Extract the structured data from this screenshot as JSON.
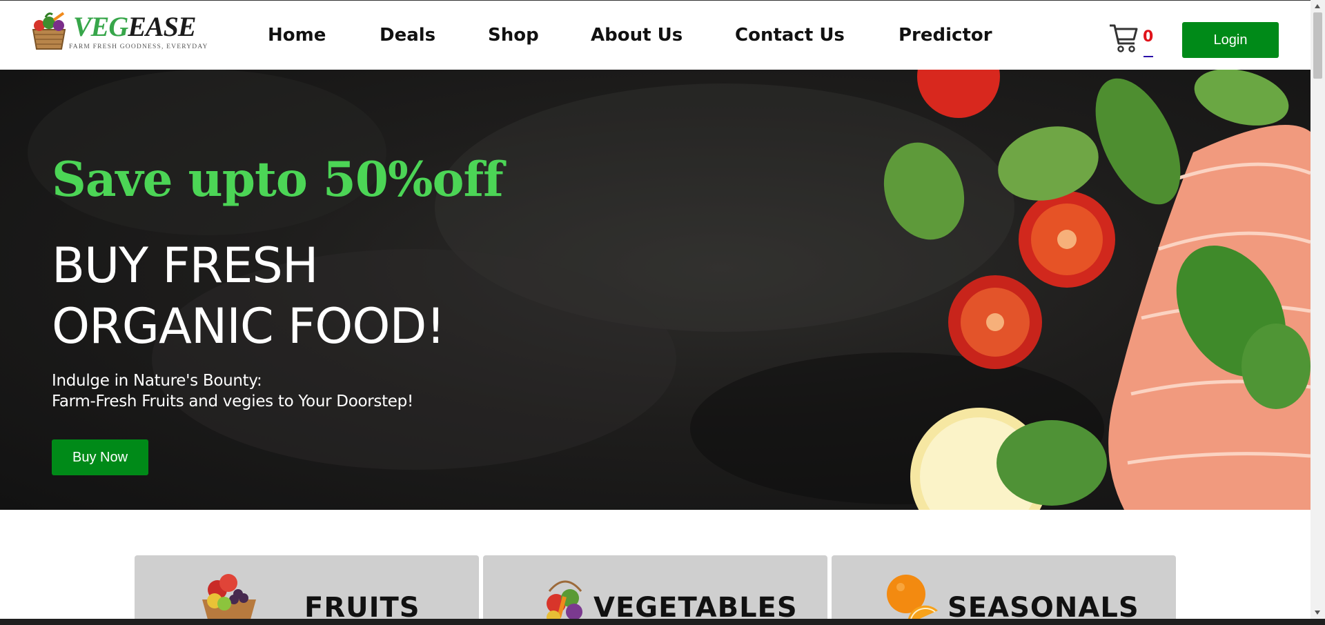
{
  "brand": {
    "name_part1": "VEG",
    "name_part2": "EASE",
    "tagline": "FARM FRESH GOODNESS, EVERYDAY",
    "icon": "vegetable-basket-logo"
  },
  "nav": {
    "items": [
      {
        "label": "Home"
      },
      {
        "label": "Deals"
      },
      {
        "label": "Shop"
      },
      {
        "label": "About Us"
      },
      {
        "label": "Contact Us"
      },
      {
        "label": "Predictor"
      }
    ]
  },
  "cart": {
    "icon": "cart-icon",
    "count": "0",
    "count_color": "#e0131b"
  },
  "login": {
    "label": "Login",
    "color": "#008a18"
  },
  "hero": {
    "promo": "Save upto 50%off",
    "promo_color": "#4cd556",
    "headline_line1": "BUY FRESH",
    "headline_line2": "ORGANIC FOOD!",
    "sub_line1": "Indulge in Nature's Bounty:",
    "sub_line2": "Farm-Fresh Fruits and vegies to Your Doorstep!",
    "cta_label": "Buy Now",
    "decor": "tomatoes-basil-salmon-lemon"
  },
  "categories": [
    {
      "label": "FRUITS",
      "icon": "fruit-basket-icon"
    },
    {
      "label": "VEGETABLES",
      "icon": "vegetable-bag-icon"
    },
    {
      "label": "SEASONALS",
      "icon": "orange-icon"
    }
  ]
}
